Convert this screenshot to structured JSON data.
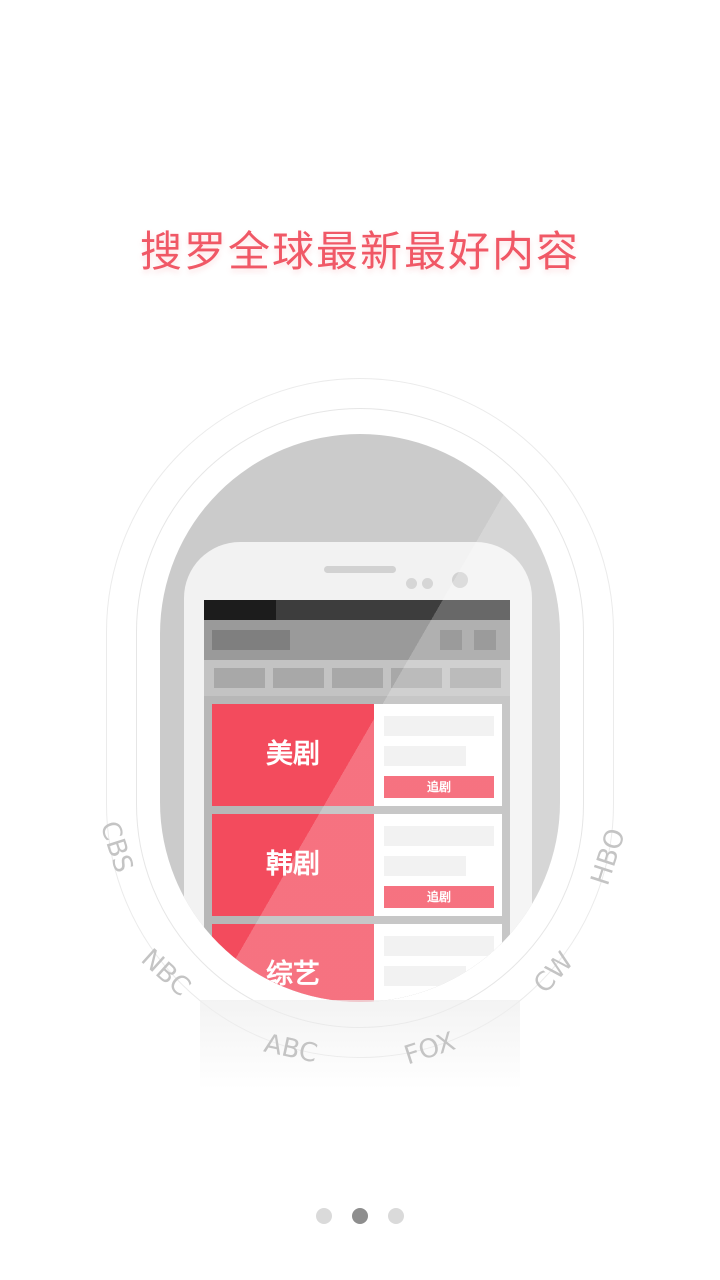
{
  "headline": "搜罗全球最新最好内容",
  "cards": [
    {
      "label": "美剧",
      "button": "追剧"
    },
    {
      "label": "韩剧",
      "button": "追剧"
    },
    {
      "label": "综艺",
      "button": ""
    }
  ],
  "networks": [
    "CBS",
    "NBC",
    "ABC",
    "FOX",
    "CW",
    "HBO"
  ],
  "pager": {
    "count": 3,
    "active_index": 1
  },
  "colors": {
    "accent": "#f34b5d",
    "headline": "#f05866"
  }
}
